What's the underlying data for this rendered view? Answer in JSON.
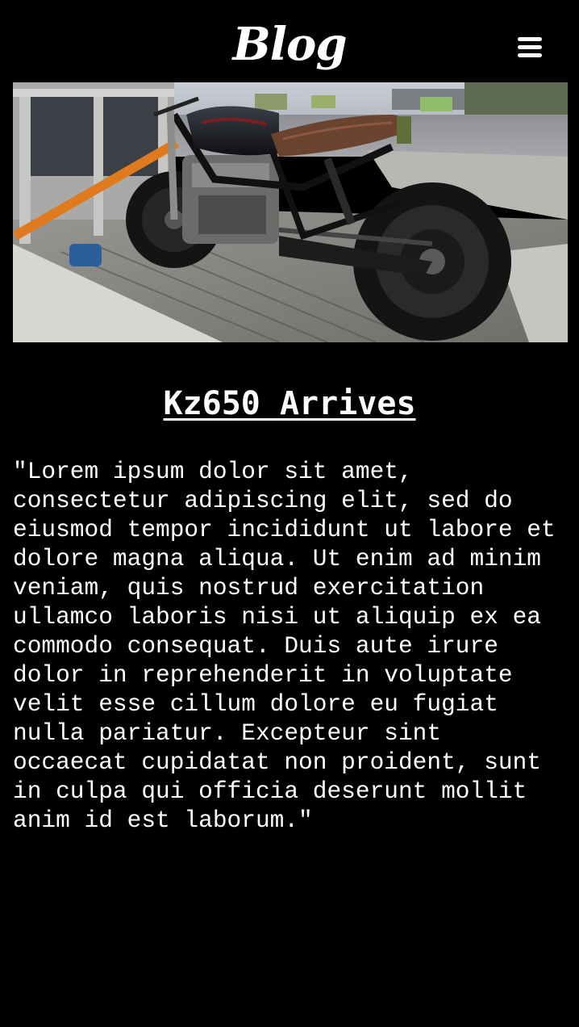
{
  "header": {
    "brand": "Blog",
    "menu_icon": "hamburger-menu-icon"
  },
  "post": {
    "image_subject": "motorcycle-on-truck-bed",
    "title": "Kz650 Arrives",
    "body": "\"Lorem ipsum dolor sit amet, consectetur adipiscing elit, sed do eiusmod tempor incididunt ut labore et dolore magna aliqua. Ut enim ad minim veniam, quis nostrud exercitation ullamco laboris nisi ut aliquip ex ea commodo consequat. Duis aute irure dolor in reprehenderit in voluptate velit esse cillum dolore eu fugiat nulla pariatur. Excepteur sint occaecat cupidatat non proident, sunt in culpa qui officia deserunt mollit anim id est laborum.\""
  },
  "colors": {
    "background": "#000000",
    "text": "#ffffff"
  }
}
